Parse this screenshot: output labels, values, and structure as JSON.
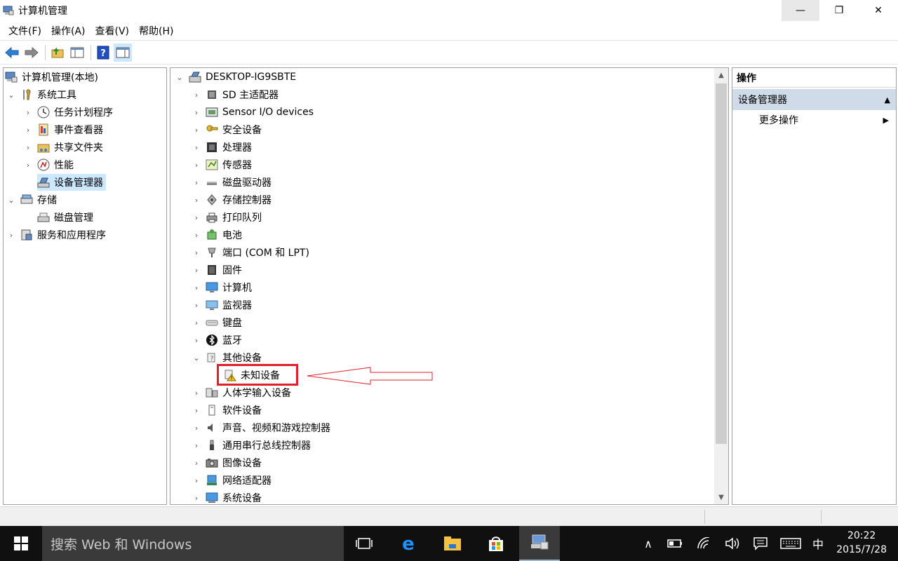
{
  "window": {
    "title": "计算机管理",
    "minimize": "—",
    "maximize": "❐",
    "close": "✕"
  },
  "menu": [
    "文件(F)",
    "操作(A)",
    "查看(V)",
    "帮助(H)"
  ],
  "left_tree": {
    "root": "计算机管理(本地)",
    "system_tools": "系统工具",
    "task_scheduler": "任务计划程序",
    "event_viewer": "事件查看器",
    "shared_folders": "共享文件夹",
    "performance": "性能",
    "device_manager": "设备管理器",
    "storage": "存储",
    "disk_management": "磁盘管理",
    "services_apps": "服务和应用程序"
  },
  "device_tree": {
    "computer": "DESKTOP-IG9SBTE",
    "categories": [
      {
        "label": "SD 主适配器",
        "icon": "sd-adapter-icon"
      },
      {
        "label": "Sensor I/O devices",
        "icon": "sensor-io-icon"
      },
      {
        "label": "安全设备",
        "icon": "security-key-icon"
      },
      {
        "label": "处理器",
        "icon": "processor-icon"
      },
      {
        "label": "传感器",
        "icon": "sensor-icon"
      },
      {
        "label": "磁盘驱动器",
        "icon": "disk-drive-icon"
      },
      {
        "label": "存储控制器",
        "icon": "storage-controller-icon"
      },
      {
        "label": "打印队列",
        "icon": "printer-icon"
      },
      {
        "label": "电池",
        "icon": "battery-icon"
      },
      {
        "label": "端口 (COM 和 LPT)",
        "icon": "port-icon"
      },
      {
        "label": "固件",
        "icon": "firmware-icon"
      },
      {
        "label": "计算机",
        "icon": "computer-icon"
      },
      {
        "label": "监视器",
        "icon": "monitor-icon"
      },
      {
        "label": "键盘",
        "icon": "keyboard-icon"
      },
      {
        "label": "蓝牙",
        "icon": "bluetooth-icon"
      },
      {
        "label": "其他设备",
        "icon": "other-devices-icon"
      },
      {
        "label": "人体学输入设备",
        "icon": "hid-icon"
      },
      {
        "label": "软件设备",
        "icon": "software-device-icon"
      },
      {
        "label": "声音、视频和游戏控制器",
        "icon": "sound-icon"
      },
      {
        "label": "通用串行总线控制器",
        "icon": "usb-icon"
      },
      {
        "label": "图像设备",
        "icon": "camera-icon"
      },
      {
        "label": "网络适配器",
        "icon": "network-adapter-icon"
      },
      {
        "label": "系统设备",
        "icon": "system-device-icon"
      }
    ],
    "unknown_device": "未知设备"
  },
  "actions": {
    "header": "操作",
    "section": "设备管理器",
    "more": "更多操作"
  },
  "taskbar": {
    "search_placeholder": "搜索 Web 和 Windows",
    "ime": "中",
    "time": "20:22",
    "date": "2015/7/28"
  },
  "colors": {
    "selection": "#cce8ff",
    "annotation_red": "#e0202a",
    "taskbar_bg": "#101010"
  }
}
